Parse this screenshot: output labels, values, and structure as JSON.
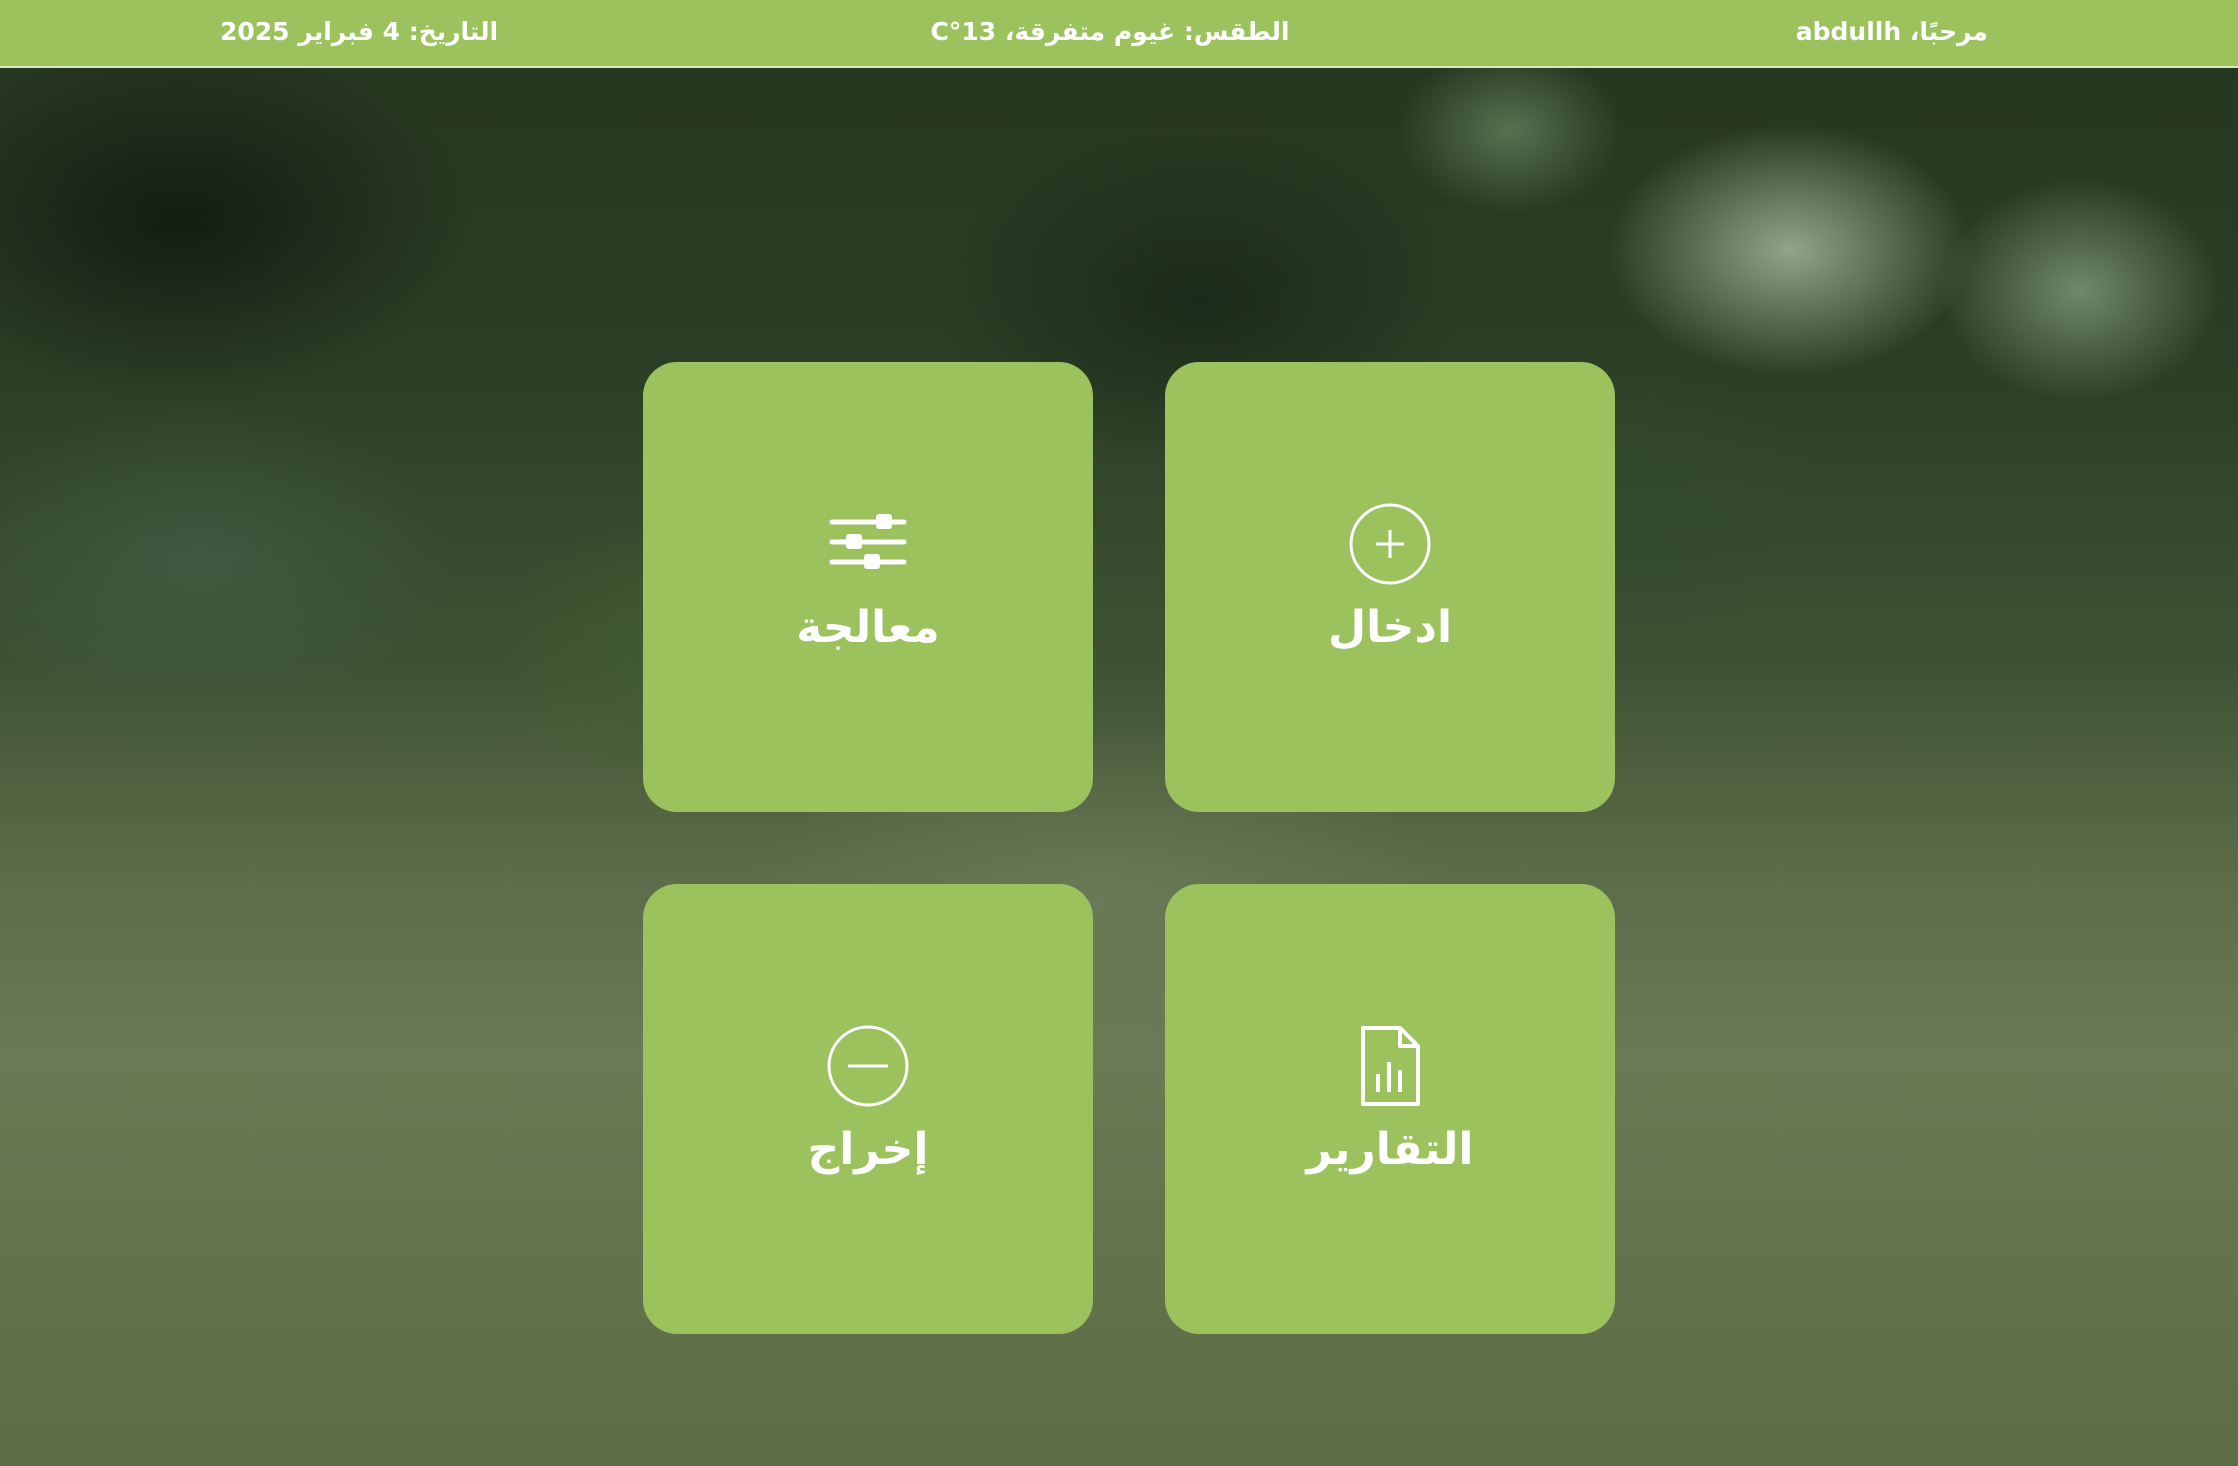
{
  "header": {
    "greeting": "مرحبًا، abdullh",
    "weather": "الطقس: غيوم متفرقة، 13°C",
    "date": "التاريخ: 4 فبراير 2025"
  },
  "tiles": [
    {
      "label": "معالجة",
      "icon": "sliders-icon"
    },
    {
      "label": "ادخال",
      "icon": "plus-circle-icon"
    },
    {
      "label": "إخراج",
      "icon": "minus-circle-icon"
    },
    {
      "label": "التقارير",
      "icon": "report-chart-icon"
    }
  ],
  "colors": {
    "accent": "#9cc25e",
    "text": "#ffffff"
  }
}
